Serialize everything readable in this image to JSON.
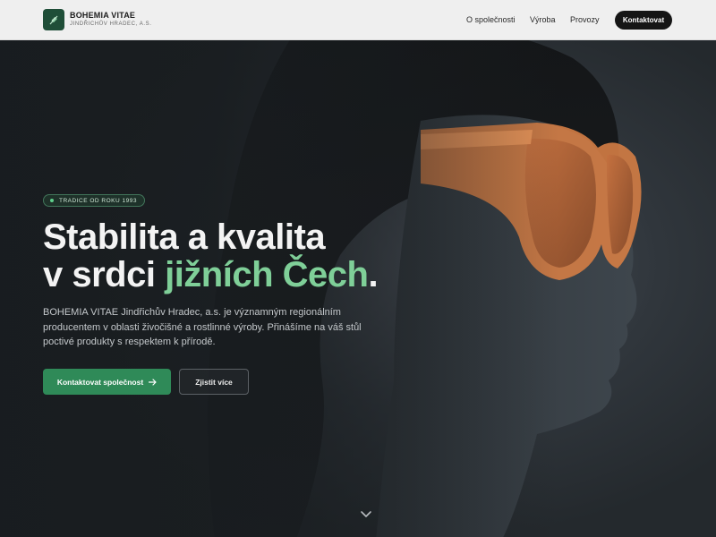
{
  "header": {
    "brand_name": "BOHEMIA VITAE",
    "brand_sub": "JINDŘICHŮV HRADEC, A.S.",
    "logo_icon": "wheat-icon",
    "nav": [
      {
        "label": "O společnosti"
      },
      {
        "label": "Výroba"
      },
      {
        "label": "Provozy"
      }
    ],
    "cta_label": "Kontaktovat"
  },
  "hero": {
    "badge": "TRADICE OD ROKU 1993",
    "title_line1": "Stabilita a kvalita",
    "title_line2_prefix": "v srdci ",
    "title_line2_accent": "jižních Čech",
    "title_line2_suffix": ".",
    "description": "BOHEMIA VITAE Jindřichův Hradec, a.s. je významným regionálním producentem v oblasti živočišné a rostlinné výroby. Přinášíme na váš stůl poctivé produkty s respektem k přírodě.",
    "primary_button": "Kontaktovat společnost",
    "secondary_button": "Zjistit více",
    "scroll_icon": "chevron-down-icon"
  },
  "colors": {
    "accent_green": "#7fcf98",
    "button_green": "#2f8a58",
    "logo_green": "#1f4e38",
    "dark_cta": "#151515",
    "glasses_orange": "#e08a52"
  }
}
